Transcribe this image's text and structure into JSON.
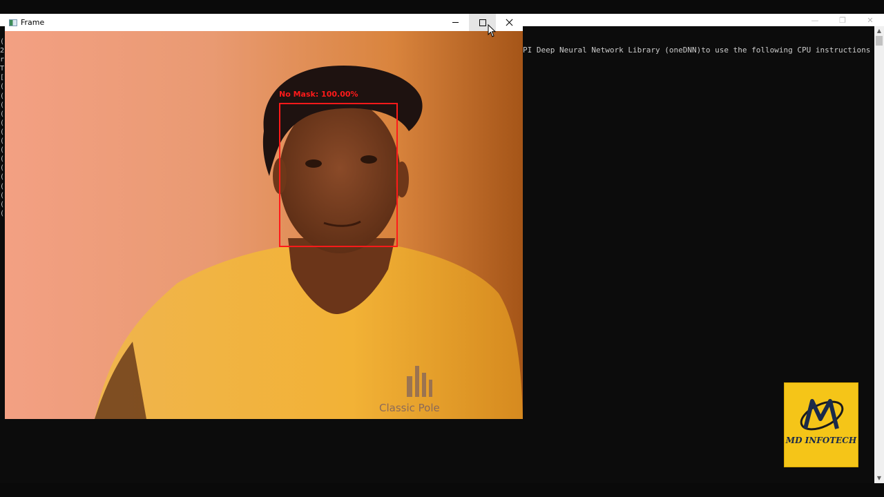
{
  "frame_window": {
    "title": "Frame",
    "detection": {
      "label": "No Mask: 100.00%",
      "color": "#ff1a1a"
    }
  },
  "console": {
    "line": "PI Deep Neural Network Library (oneDNN)to use the following CPU instructions in perfo",
    "left_edge_chars": "(\n2\nr\nT\n[\n(\n(\n(\n(\n(\n(\n(\n(\n(\n(\n(\n(\n(\n(\n("
  },
  "video_overlay": {
    "shirt_text": "Classic Pole"
  },
  "logo": {
    "text": "MD INFOTECH"
  },
  "icons": {
    "app": "window-app-icon",
    "minimize": "minimize-icon",
    "maximize": "maximize-icon",
    "close": "close-icon",
    "cursor": "mouse-pointer-icon"
  }
}
